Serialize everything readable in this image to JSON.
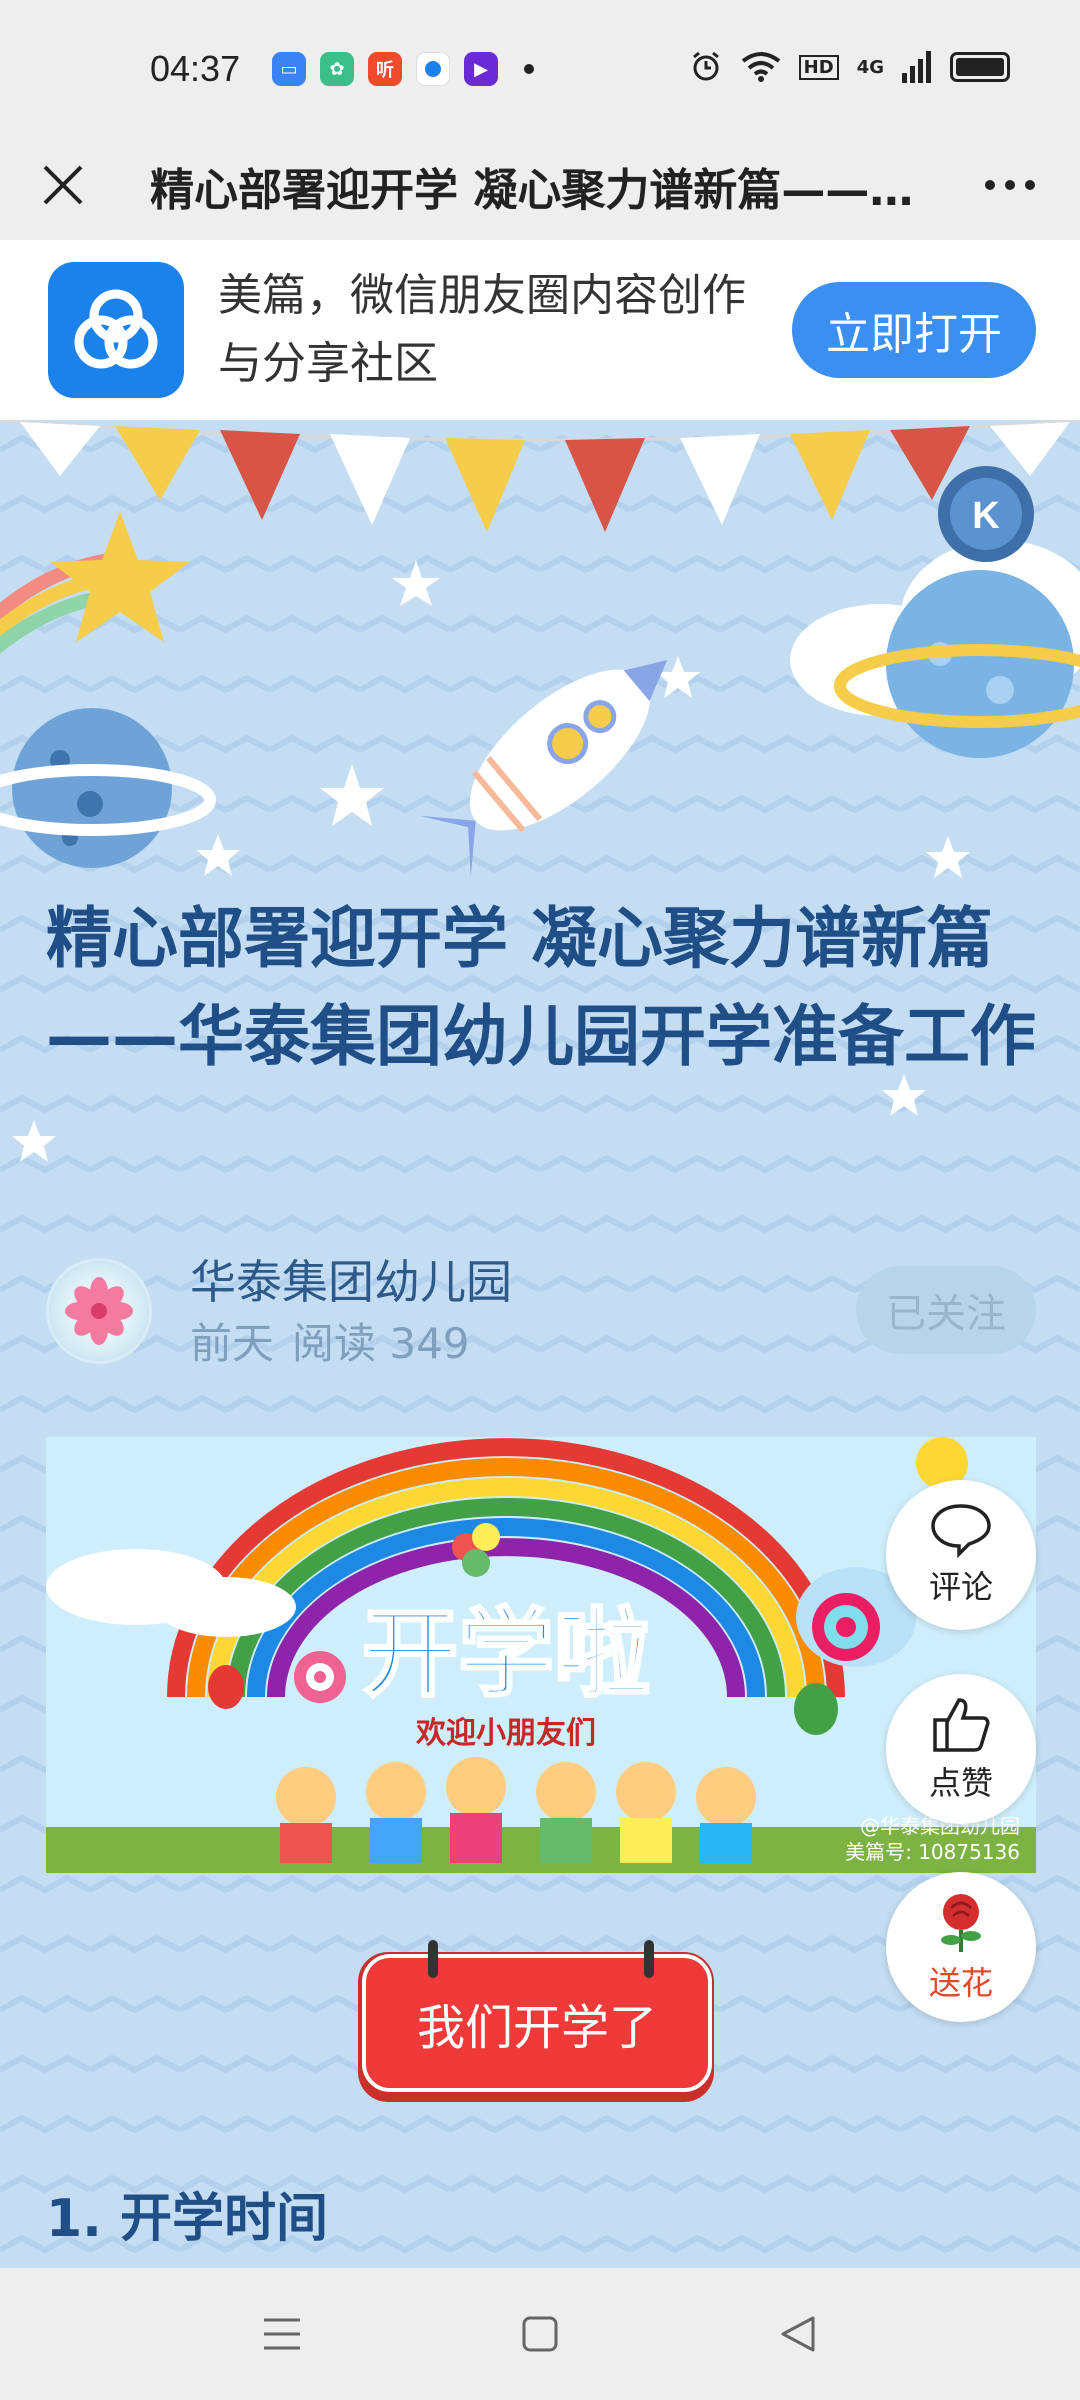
{
  "status_bar": {
    "time": "04:37",
    "notification_icons": [
      "meipian-app-icon",
      "app-green-icon",
      "ting-app-icon",
      "app-blue-dot-icon",
      "video-app-icon"
    ],
    "ting_label": "听",
    "hd_label": "HD",
    "network_label": "4G"
  },
  "title_bar": {
    "title": "精心部署迎开学 凝心聚力谱新篇——华泰集团幼儿园开学准备工作"
  },
  "promo": {
    "description": "美篇，微信朋友圈内容创作与分享社区",
    "open_label": "立即打开"
  },
  "article": {
    "title": "精心部署迎开学 凝心聚力谱新篇——华泰集团幼儿园开学准备工作",
    "author": "华泰集团幼儿园",
    "date": "前天",
    "reads_label": "阅读 349",
    "follow_label": "已关注",
    "banner": {
      "headline": "开学啦",
      "subline": "欢迎小朋友们",
      "watermark_line1": "@华泰集团幼儿园",
      "watermark_line2": "美篇号: 10875136"
    },
    "section_button": "我们开学了",
    "section_heading": "1. 开学时间"
  },
  "side_actions": {
    "comment": "评论",
    "like": "点赞",
    "flower": "送花"
  },
  "colors": {
    "content_bg": "#c4ddf2",
    "title_blue": "#1f4f86",
    "accent_blue": "#3a8ff0",
    "section_red": "#f03a3a"
  }
}
